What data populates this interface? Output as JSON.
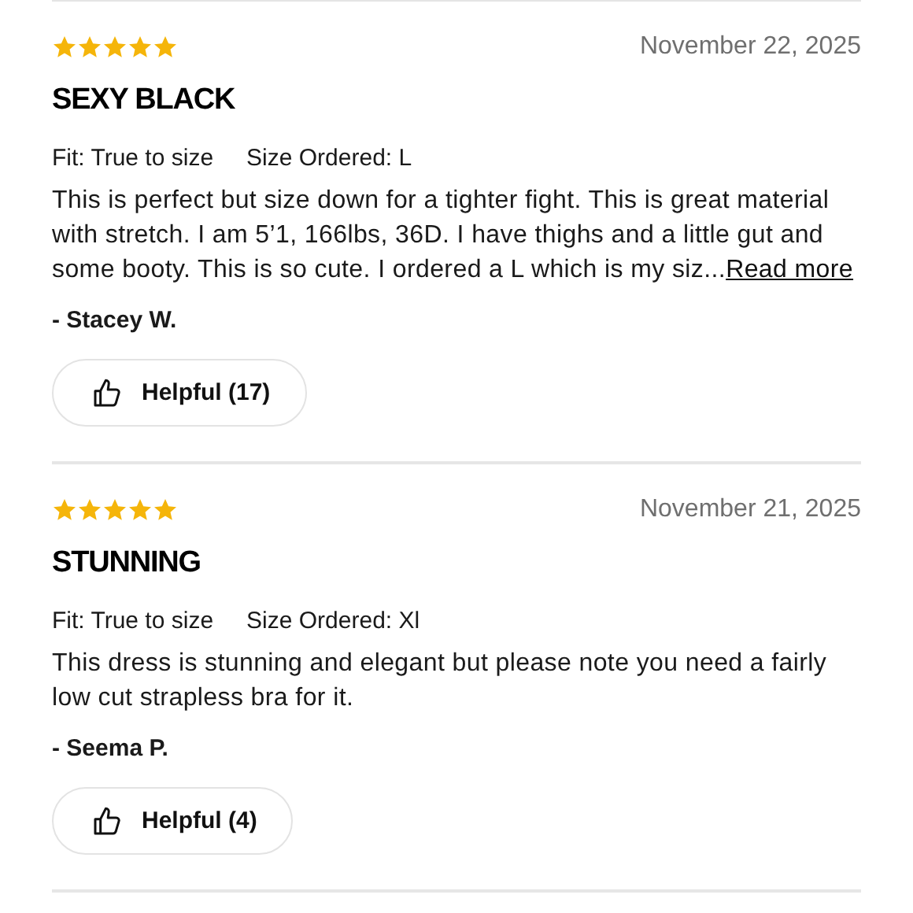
{
  "reviews": [
    {
      "stars": 5,
      "date": "November 22, 2025",
      "title": "SEXY BLACK",
      "fit": "Fit: True to size",
      "size": "Size Ordered: L",
      "text": "This is perfect but size down for a tighter fight. This is great material with stretch. I am 5’1, 166lbs, 36D. I have thighs and a little gut and some booty. This is so cute. I ordered a L which is my siz...",
      "read_more": "Read more",
      "author": "- Stacey W.",
      "helpful": "Helpful (17)"
    },
    {
      "stars": 5,
      "date": "November 21, 2025",
      "title": "STUNNING",
      "fit": "Fit: True to size",
      "size": "Size Ordered: Xl",
      "text": "This dress is stunning and elegant but please note you need a fairly low cut strapless bra for it.",
      "author": "- Seema P.",
      "helpful": "Helpful (4)"
    }
  ]
}
